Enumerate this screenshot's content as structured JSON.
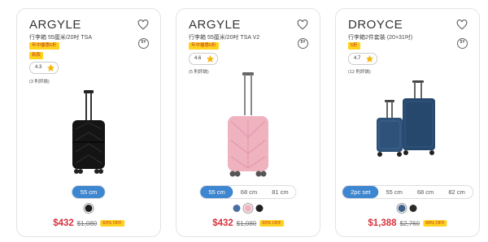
{
  "products": [
    {
      "brand": "ARGYLE",
      "name": "行李箱 55厘米/20吋 TSA",
      "badges": [
        "年中優惠6折",
        "新款"
      ],
      "rating": "4.3",
      "reviews": "(3 則評論)",
      "sizes": [
        "55 cm"
      ],
      "active_size": 0,
      "swatches": [
        "#1c1c1c"
      ],
      "selected_swatch": 0,
      "price": "$432",
      "original_price": "$1,080",
      "discount": "60% OFF",
      "warranty": "5Y"
    },
    {
      "brand": "ARGYLE",
      "name": "行李箱 55厘米/20吋 TSA V2",
      "badges": [
        "年中優惠6折"
      ],
      "rating": "4.6",
      "reviews": "(5 則評論)",
      "sizes": [
        "55 cm",
        "68 cm",
        "81 cm"
      ],
      "active_size": 0,
      "swatches": [
        "#4a6fa0",
        "#f2b3c0",
        "#222222"
      ],
      "selected_swatch": 1,
      "price": "$432",
      "original_price": "$1,080",
      "discount": "60% OFF",
      "warranty": "5Y"
    },
    {
      "brand": "DROYCE",
      "name": "行李箱2件套裝 (20+31吋)",
      "badges": [
        "5折"
      ],
      "rating": "4.7",
      "reviews": "(12 則評論)",
      "sizes": [
        "2pc set",
        "55 cm",
        "68 cm",
        "82 cm"
      ],
      "active_size": 0,
      "swatches": [
        "#3e5f86",
        "#2b2b2b"
      ],
      "selected_swatch": 0,
      "price": "$1,388",
      "original_price": "$2,760",
      "discount": "49% OFF",
      "warranty": "5Y"
    }
  ]
}
